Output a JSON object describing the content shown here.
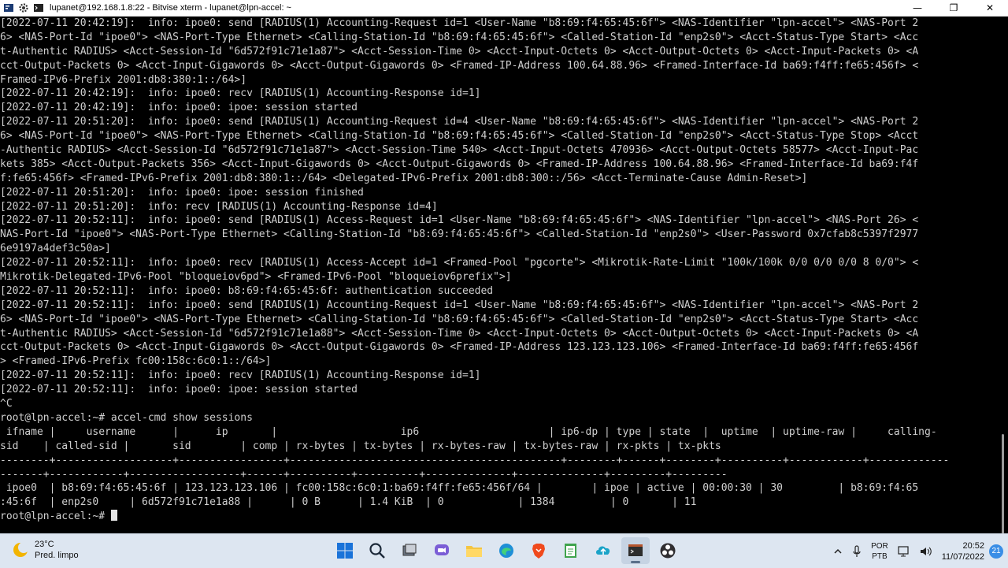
{
  "window": {
    "title": "lupanet@192.168.1.8:22 - Bitvise xterm - lupanet@lpn-accel: ~",
    "controls": {
      "minimize": "—",
      "maximize": "❐",
      "close": "✕"
    }
  },
  "terminal": {
    "lines": [
      "[2022-07-11 20:42:19]:  info: ipoe0: send [RADIUS(1) Accounting-Request id=1 <User-Name \"b8:69:f4:65:45:6f\"> <NAS-Identifier \"lpn-accel\"> <NAS-Port 2",
      "6> <NAS-Port-Id \"ipoe0\"> <NAS-Port-Type Ethernet> <Calling-Station-Id \"b8:69:f4:65:45:6f\"> <Called-Station-Id \"enp2s0\"> <Acct-Status-Type Start> <Acc",
      "t-Authentic RADIUS> <Acct-Session-Id \"6d572f91c71e1a87\"> <Acct-Session-Time 0> <Acct-Input-Octets 0> <Acct-Output-Octets 0> <Acct-Input-Packets 0> <A",
      "cct-Output-Packets 0> <Acct-Input-Gigawords 0> <Acct-Output-Gigawords 0> <Framed-IP-Address 100.64.88.96> <Framed-Interface-Id ba69:f4ff:fe65:456f> <",
      "Framed-IPv6-Prefix 2001:db8:380:1::/64>]",
      "[2022-07-11 20:42:19]:  info: ipoe0: recv [RADIUS(1) Accounting-Response id=1]",
      "[2022-07-11 20:42:19]:  info: ipoe0: ipoe: session started",
      "[2022-07-11 20:51:20]:  info: ipoe0: send [RADIUS(1) Accounting-Request id=4 <User-Name \"b8:69:f4:65:45:6f\"> <NAS-Identifier \"lpn-accel\"> <NAS-Port 2",
      "6> <NAS-Port-Id \"ipoe0\"> <NAS-Port-Type Ethernet> <Calling-Station-Id \"b8:69:f4:65:45:6f\"> <Called-Station-Id \"enp2s0\"> <Acct-Status-Type Stop> <Acct",
      "-Authentic RADIUS> <Acct-Session-Id \"6d572f91c71e1a87\"> <Acct-Session-Time 540> <Acct-Input-Octets 470936> <Acct-Output-Octets 58577> <Acct-Input-Pac",
      "kets 385> <Acct-Output-Packets 356> <Acct-Input-Gigawords 0> <Acct-Output-Gigawords 0> <Framed-IP-Address 100.64.88.96> <Framed-Interface-Id ba69:f4f",
      "f:fe65:456f> <Framed-IPv6-Prefix 2001:db8:380:1::/64> <Delegated-IPv6-Prefix 2001:db8:300::/56> <Acct-Terminate-Cause Admin-Reset>]",
      "[2022-07-11 20:51:20]:  info: ipoe0: ipoe: session finished",
      "[2022-07-11 20:51:20]:  info: recv [RADIUS(1) Accounting-Response id=4]",
      "[2022-07-11 20:52:11]:  info: ipoe0: send [RADIUS(1) Access-Request id=1 <User-Name \"b8:69:f4:65:45:6f\"> <NAS-Identifier \"lpn-accel\"> <NAS-Port 26> <",
      "NAS-Port-Id \"ipoe0\"> <NAS-Port-Type Ethernet> <Calling-Station-Id \"b8:69:f4:65:45:6f\"> <Called-Station-Id \"enp2s0\"> <User-Password 0x7cfab8c5397f2977",
      "6e9197a4def3c50a>]",
      "[2022-07-11 20:52:11]:  info: ipoe0: recv [RADIUS(1) Access-Accept id=1 <Framed-Pool \"pgcorte\"> <Mikrotik-Rate-Limit \"100k/100k 0/0 0/0 0/0 8 0/0\"> <",
      "Mikrotik-Delegated-IPv6-Pool \"bloqueiov6pd\"> <Framed-IPv6-Pool \"bloqueiov6prefix\">]",
      "[2022-07-11 20:52:11]:  info: ipoe0: b8:69:f4:65:45:6f: authentication succeeded",
      "[2022-07-11 20:52:11]:  info: ipoe0: send [RADIUS(1) Accounting-Request id=1 <User-Name \"b8:69:f4:65:45:6f\"> <NAS-Identifier \"lpn-accel\"> <NAS-Port 2",
      "6> <NAS-Port-Id \"ipoe0\"> <NAS-Port-Type Ethernet> <Calling-Station-Id \"b8:69:f4:65:45:6f\"> <Called-Station-Id \"enp2s0\"> <Acct-Status-Type Start> <Acc",
      "t-Authentic RADIUS> <Acct-Session-Id \"6d572f91c71e1a88\"> <Acct-Session-Time 0> <Acct-Input-Octets 0> <Acct-Output-Octets 0> <Acct-Input-Packets 0> <A",
      "cct-Output-Packets 0> <Acct-Input-Gigawords 0> <Acct-Output-Gigawords 0> <Framed-IP-Address 123.123.123.106> <Framed-Interface-Id ba69:f4ff:fe65:456f",
      "> <Framed-IPv6-Prefix fc00:158c:6c0:1::/64>]",
      "[2022-07-11 20:52:11]:  info: ipoe0: recv [RADIUS(1) Accounting-Response id=1]",
      "[2022-07-11 20:52:11]:  info: ipoe0: ipoe: session started",
      "^C",
      "root@lpn-accel:~# accel-cmd show sessions",
      " ifname |     username      |      ip       |                    ip6                     | ip6-dp | type | state  |  uptime  | uptime-raw |     calling-",
      "sid    | called-sid |       sid        | comp | rx-bytes | tx-bytes | rx-bytes-raw | tx-bytes-raw | rx-pkts | tx-pkts",
      "--------+-------------------+-----------------+--------------------------------------------+--------+------+--------+----------+------------+-------------",
      "-------+------------+------------------+------+----------+----------+--------------+--------------+---------+---------",
      " ipoe0  | b8:69:f4:65:45:6f | 123.123.123.106 | fc00:158c:6c0:1:ba69:f4ff:fe65:456f/64 |        | ipoe | active | 00:00:30 | 30         | b8:69:f4:65",
      ":45:6f  | enp2s0     | 6d572f91c71e1a88 |      | 0 B      | 1.4 KiB  | 0            | 1384         | 0       | 11"
    ],
    "prompt": "root@lpn-accel:~# "
  },
  "taskbar": {
    "weather_temp": "23°C",
    "weather_desc": "Pred. limpo",
    "language_top": "POR",
    "language_bottom": "PTB",
    "time": "20:52",
    "date": "11/07/2022",
    "notification_count": "21"
  }
}
